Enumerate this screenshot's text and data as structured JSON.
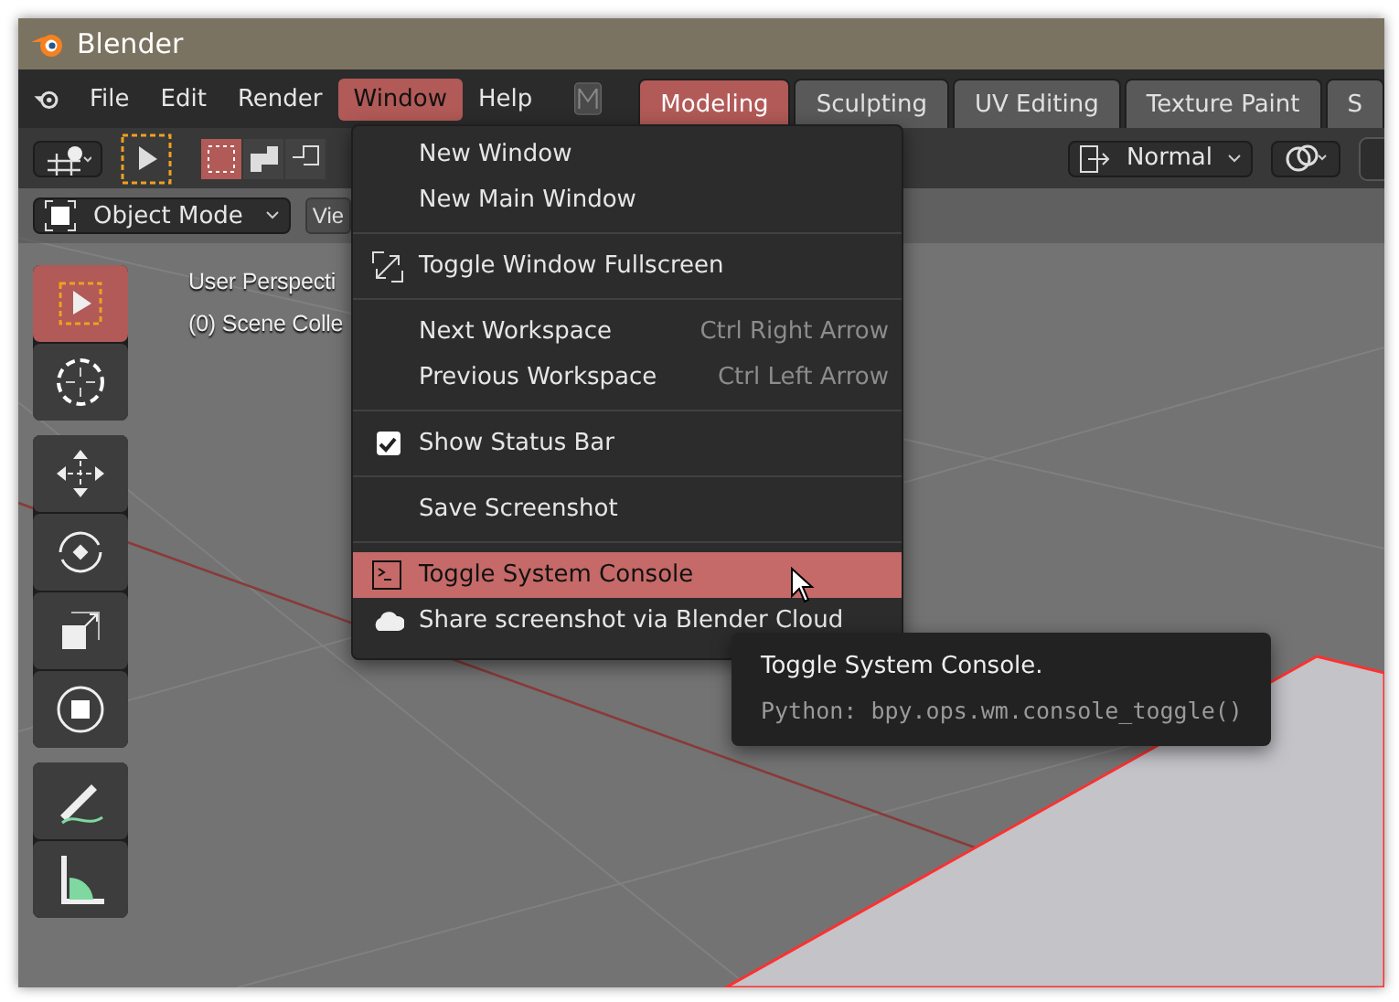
{
  "window": {
    "title": "Blender"
  },
  "menu_bar": {
    "items": [
      {
        "label": "File",
        "selected": false
      },
      {
        "label": "Edit",
        "selected": false
      },
      {
        "label": "Render",
        "selected": false
      },
      {
        "label": "Window",
        "selected": true
      },
      {
        "label": "Help",
        "selected": false
      }
    ]
  },
  "workspace_tabs": [
    {
      "label": "Modeling",
      "selected": true
    },
    {
      "label": "Sculpting",
      "selected": false
    },
    {
      "label": "UV Editing",
      "selected": false
    },
    {
      "label": "Texture Paint",
      "selected": false
    },
    {
      "label": "S",
      "selected": false
    }
  ],
  "viewport_header": {
    "shading_mode": "Normal",
    "mode": "Object Mode",
    "menu": "Vie"
  },
  "viewport_overlay": [
    "User Perspecti",
    "(0) Scene Colle"
  ],
  "tools": [
    [
      {
        "kind": "select",
        "selected": true
      },
      {
        "kind": "cursor",
        "selected": false
      }
    ],
    [
      {
        "kind": "move",
        "selected": false
      },
      {
        "kind": "rotate",
        "selected": false
      },
      {
        "kind": "scale",
        "selected": false
      },
      {
        "kind": "transform",
        "selected": false
      }
    ],
    [
      {
        "kind": "annotate",
        "selected": false
      },
      {
        "kind": "measure",
        "selected": false
      }
    ]
  ],
  "window_menu": [
    [
      {
        "kind": "plain",
        "label": "New Window",
        "selected": false
      },
      {
        "kind": "plain",
        "label": "New Main Window",
        "selected": false
      }
    ],
    [
      {
        "kind": "fullscreen",
        "label": "Toggle Window Fullscreen",
        "selected": false
      }
    ],
    [
      {
        "kind": "plain",
        "label": "Next Workspace",
        "shortcut": "Ctrl Right Arrow",
        "selected": false
      },
      {
        "kind": "plain",
        "label": "Previous Workspace",
        "shortcut": "Ctrl Left Arrow",
        "selected": false
      }
    ],
    [
      {
        "kind": "checkbox",
        "label": "Show Status Bar",
        "checked": true,
        "selected": false
      }
    ],
    [
      {
        "kind": "plain",
        "label": "Save Screenshot",
        "selected": false
      }
    ],
    [
      {
        "kind": "console",
        "label": "Toggle System Console",
        "selected": true
      },
      {
        "kind": "cloud",
        "label": "Share screenshot via Blender Cloud",
        "selected": false
      }
    ]
  ],
  "tooltip": {
    "title": "Toggle System Console.",
    "python": "Python: bpy.ops.wm.console_toggle()"
  }
}
